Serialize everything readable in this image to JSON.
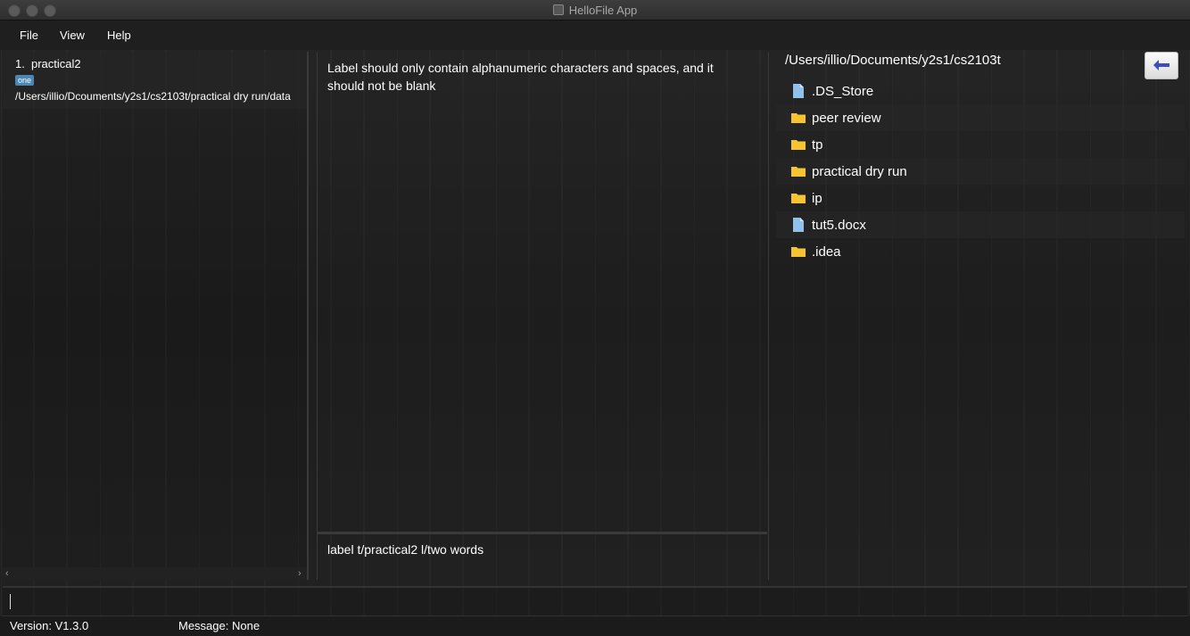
{
  "window": {
    "title": "HelloFile App"
  },
  "menu": {
    "file": "File",
    "view": "View",
    "help": "Help"
  },
  "left_panel": {
    "items": [
      {
        "index": "1.",
        "name": "practical2",
        "tag": "one",
        "path": "/Users/illio/Dcouments/y2s1/cs2103t/practical dry run/data"
      }
    ]
  },
  "result": {
    "text": "Label should only contain alphanumeric characters and spaces, and it should not be blank"
  },
  "history": {
    "command": "label t/practical2 l/two words"
  },
  "file_browser": {
    "current_path": "/Users/illio/Documents/y2s1/cs2103t",
    "back_icon": "left-arrow-icon",
    "entries": [
      {
        "name": ".DS_Store",
        "type": "file"
      },
      {
        "name": "peer review",
        "type": "folder"
      },
      {
        "name": "tp",
        "type": "folder"
      },
      {
        "name": "practical dry run",
        "type": "folder"
      },
      {
        "name": "ip",
        "type": "folder"
      },
      {
        "name": "tut5.docx",
        "type": "file"
      },
      {
        "name": ".idea",
        "type": "folder"
      }
    ]
  },
  "command_box": {
    "value": ""
  },
  "status": {
    "version": "Version:  V1.3.0",
    "message": "Message:  None"
  },
  "colors": {
    "folder": "#f7c431",
    "file": "#8fc1ec",
    "tag": "#4b86b4",
    "back_arrow": "#3a4fb8"
  }
}
